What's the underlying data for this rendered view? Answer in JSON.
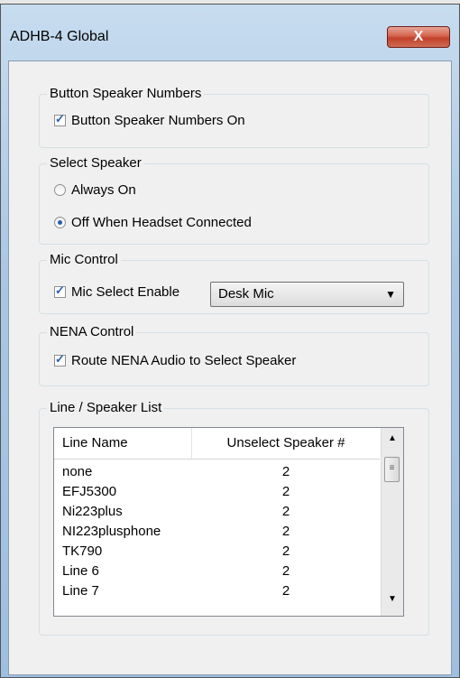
{
  "window": {
    "title": "ADHB-4 Global",
    "close_label": "X"
  },
  "groups": {
    "button_speaker_numbers": {
      "legend": "Button Speaker Numbers",
      "checkbox_label": "Button Speaker Numbers On",
      "checked": true
    },
    "select_speaker": {
      "legend": "Select Speaker",
      "options": [
        {
          "label": "Always On",
          "selected": false
        },
        {
          "label": "Off When Headset Connected",
          "selected": true
        }
      ]
    },
    "mic_control": {
      "legend": "Mic Control",
      "checkbox_label": "Mic Select Enable",
      "checked": true,
      "select_value": "Desk Mic"
    },
    "nena_control": {
      "legend": "NENA Control",
      "checkbox_label": "Route NENA Audio to Select Speaker",
      "checked": true
    },
    "line_speaker_list": {
      "legend": "Line / Speaker List",
      "columns": [
        "Line Name",
        "Unselect Speaker #"
      ],
      "rows": [
        [
          "none",
          "2"
        ],
        [
          "EFJ5300",
          "2"
        ],
        [
          "Ni223plus",
          "2"
        ],
        [
          "NI223plusphone",
          "2"
        ],
        [
          "TK790",
          "2"
        ],
        [
          "Line 6",
          "2"
        ],
        [
          "Line 7",
          "2"
        ]
      ]
    }
  },
  "icons": {
    "close": "close-icon",
    "dropdown": "chevron-down-icon",
    "scroll_up": "scroll-up-icon",
    "scroll_down": "scroll-down-icon"
  }
}
